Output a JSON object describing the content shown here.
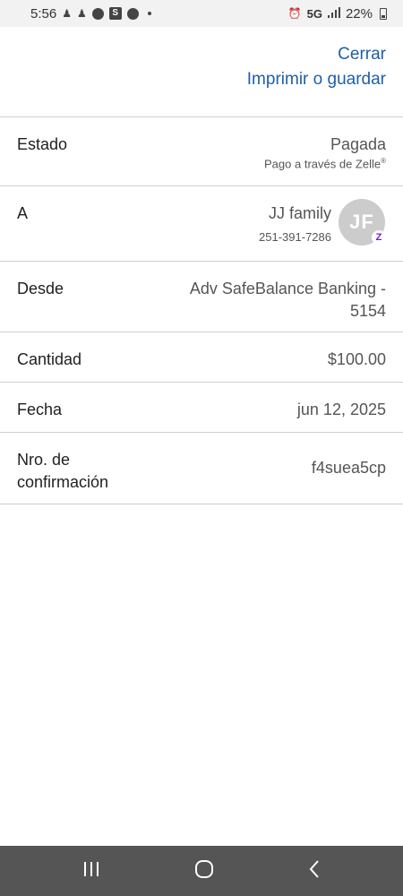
{
  "status_bar": {
    "time": "5:56",
    "network": "5G",
    "battery": "22%"
  },
  "header": {
    "close_label": "Cerrar",
    "print_label": "Imprimir o guardar"
  },
  "details": {
    "status_label": "Estado",
    "status_value": "Pagada",
    "status_sub": "Pago a través de Zelle",
    "status_sub_mark": "®",
    "to_label": "A",
    "to_name": "JJ family",
    "to_phone": "251-391-7286",
    "to_initials": "JF",
    "to_badge": "Z",
    "from_label": "Desde",
    "from_value": "Adv SafeBalance Banking - 5154",
    "amount_label": "Cantidad",
    "amount_value": "$100.00",
    "date_label": "Fecha",
    "date_value": "jun 12, 2025",
    "confirmation_label": "Nro. de confirmación",
    "confirmation_value": "f4suea5cp"
  },
  "colors": {
    "link": "#1f5fa6",
    "zelle_purple": "#6d1ed4",
    "navbar": "#555555"
  },
  "icons": {
    "status_bar_left": [
      "contacts-icon",
      "contacts-icon",
      "messenger-icon",
      "s-app-icon",
      "messenger-icon"
    ],
    "status_bar_right": [
      "alarm-icon",
      "signal-icon",
      "battery-icon"
    ],
    "nav": [
      "recent-apps-icon",
      "home-icon",
      "back-icon"
    ]
  }
}
